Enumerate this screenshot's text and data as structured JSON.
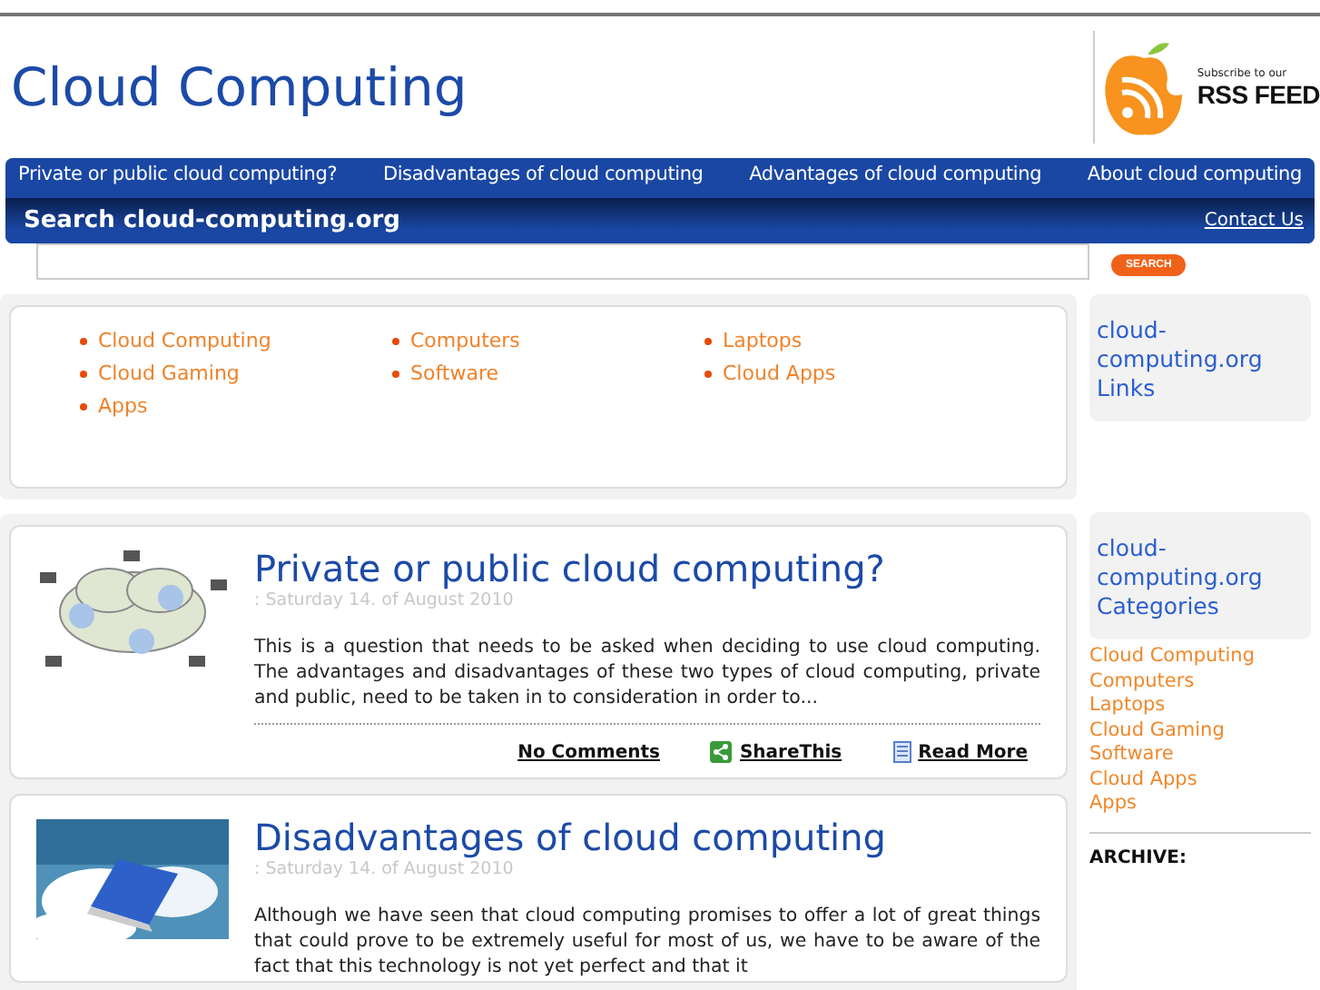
{
  "site_title": "Cloud Computing",
  "rss": {
    "caption": "Subscribe to our",
    "label": "RSS FEED"
  },
  "nav": [
    {
      "label": "Private or public cloud computing?"
    },
    {
      "label": "Disadvantages of cloud computing"
    },
    {
      "label": "Advantages of cloud computing"
    },
    {
      "label": "About cloud computing"
    }
  ],
  "search": {
    "title": "Search cloud-computing.org",
    "contact": "Contact Us",
    "button": "SEARCH"
  },
  "categories": [
    [
      "Cloud Computing",
      "Cloud Gaming",
      "Apps"
    ],
    [
      "Computers",
      "Software"
    ],
    [
      "Laptops",
      "Cloud Apps"
    ]
  ],
  "posts": [
    {
      "title": "Private or public cloud computing?",
      "date": ": Saturday 14. of August 2010",
      "excerpt": "This is a question that needs to be asked when deciding to use cloud computing. The advantages and disadvantages of these two types of cloud computing, private and public, need to be taken in to consideration in order to...",
      "actions": {
        "comments": "No Comments",
        "share": "ShareThis",
        "more": "Read More"
      }
    },
    {
      "title": "Disadvantages of cloud computing",
      "date": ": Saturday 14. of August 2010",
      "excerpt": "Although we have seen that cloud computing promises to offer a lot of great things that could prove to be extremely useful for most of us, we have to be aware of the fact that this technology is not yet perfect and that it"
    }
  ],
  "sidebar": {
    "links_title": "cloud-computing.org Links",
    "categories_title": "cloud-computing.org Categories",
    "categories": [
      "Cloud Computing",
      "Computers",
      "Laptops",
      "Cloud Gaming",
      "Software",
      "Cloud Apps",
      "Apps"
    ],
    "archive": "ARCHIVE:"
  }
}
